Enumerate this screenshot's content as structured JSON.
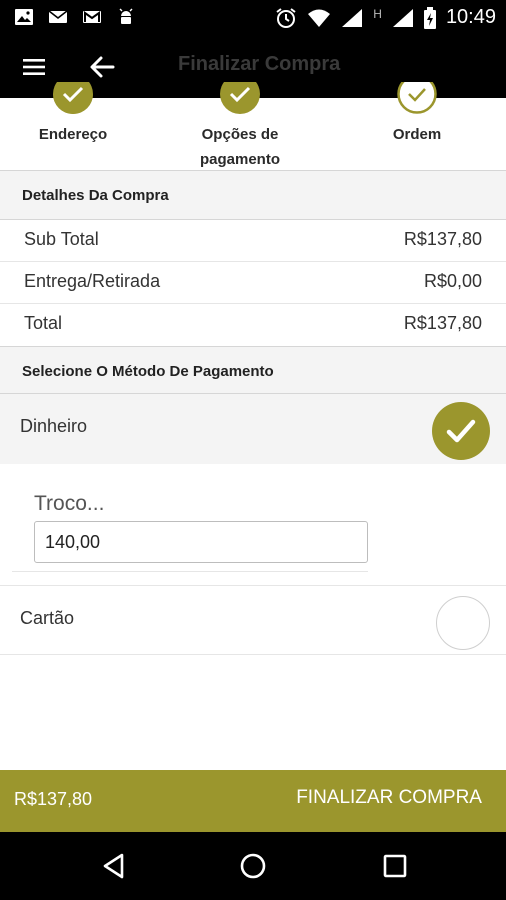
{
  "status_bar": {
    "time": "10:49",
    "network_label": "H",
    "icons": [
      "image-icon",
      "email-icon",
      "gmail-icon",
      "android-icon",
      "alarm-icon",
      "wifi-icon",
      "signal-icon",
      "battery-icon"
    ]
  },
  "app_bar": {
    "title": "Finalizar Compra",
    "icons": [
      "menu-icon",
      "back-arrow-icon"
    ]
  },
  "stepper": {
    "steps": [
      {
        "label": "Endereço",
        "state": "done"
      },
      {
        "label": "Opções de pagamento",
        "state": "done"
      },
      {
        "label": "Ordem",
        "state": "current"
      }
    ]
  },
  "purchase_details": {
    "header": "Detalhes Da Compra",
    "rows": [
      {
        "label": "Sub Total",
        "value": "R$137,80"
      },
      {
        "label": "Entrega/Retirada",
        "value": "R$0,00"
      },
      {
        "label": "Total",
        "value": "R$137,80"
      }
    ]
  },
  "payment": {
    "header": "Selecione O Método De Pagamento",
    "methods": [
      {
        "name": "Dinheiro",
        "selected": true
      },
      {
        "name": "Cartão",
        "selected": false
      }
    ],
    "change_field": {
      "placeholder": "Troco...",
      "value": "140,00"
    }
  },
  "action_bar": {
    "total": "R$137,80",
    "button_label": "FINALIZAR COMPRA"
  },
  "nav_bar": {
    "icons": [
      "back-triangle-icon",
      "home-circle-icon",
      "recents-square-icon"
    ]
  },
  "colors": {
    "accent": "#9b962d",
    "bars": "#000000",
    "section_bg": "#f4f4f4"
  }
}
